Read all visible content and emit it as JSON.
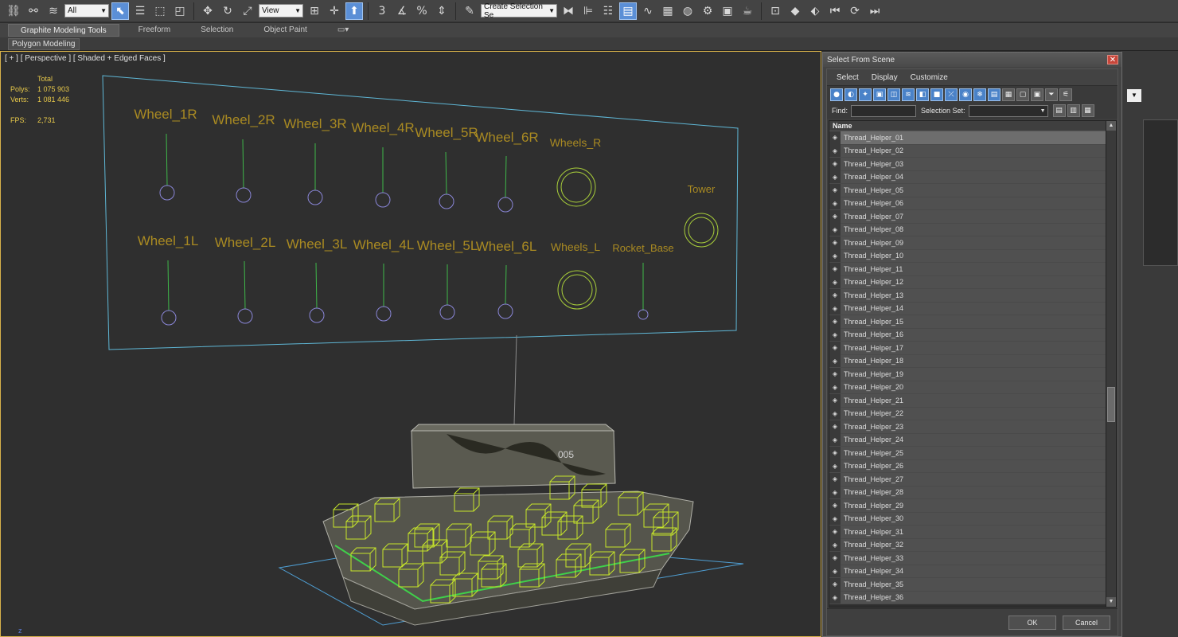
{
  "toolbar": {
    "filter_value": "All",
    "refcoord_value": "View",
    "selection_set_placeholder": "Create Selection Se",
    "icons": [
      "link-icon",
      "unlink-icon",
      "bind-spacewarp-icon",
      "select-object-icon",
      "select-by-name-icon",
      "rect-region-icon",
      "window-crossing-icon",
      "move-icon",
      "rotate-icon",
      "scale-icon",
      "pivot-icon",
      "select-manipulate-icon",
      "snap-toggle-icon",
      "angle-snap-icon",
      "percent-snap-icon",
      "spinner-snap-icon",
      "edit-named-sets-icon",
      "mirror-icon",
      "align-icon",
      "layer-manager-icon",
      "graphite-toggle-icon",
      "curve-editor-icon",
      "schematic-view-icon",
      "material-editor-icon",
      "render-setup-icon",
      "rendered-frame-icon",
      "render-icon"
    ]
  },
  "ribbon": {
    "tabs": [
      "Graphite Modeling Tools",
      "Freeform",
      "Selection",
      "Object Paint"
    ],
    "active_tab": "Graphite Modeling Tools",
    "panel_label": "Polygon Modeling"
  },
  "viewport": {
    "label": "[ + ] [ Perspective ] [ Shaded + Edged Faces ]",
    "stats_header": "Total",
    "polys_label": "Polys:",
    "polys_value": "1 075 903",
    "verts_label": "Verts:",
    "verts_value": "1 081 446",
    "fps_label": "FPS:",
    "fps_value": "2,731",
    "axis_label": "z",
    "controls_top": [
      "Wheel_1R",
      "Wheel_2R",
      "Wheel_3R",
      "Wheel_4R",
      "Wheel_5R",
      "Wheel_6R",
      "Wheels_R"
    ],
    "controls_bottom": [
      "Wheel_1L",
      "Wheel_2L",
      "Wheel_3L",
      "Wheel_4L",
      "Wheel_5L",
      "Wheel_6L",
      "Wheels_L",
      "Rocket_Base"
    ],
    "control_tower": "Tower",
    "vehicle_number": "005"
  },
  "dialog": {
    "title": "Select From Scene",
    "close_glyph": "✕",
    "menu": [
      "Select",
      "Display",
      "Customize"
    ],
    "find_label": "Find:",
    "find_value": "",
    "selection_set_label": "Selection Set:",
    "column_name": "Name",
    "items": [
      "Thread_Helper_01",
      "Thread_Helper_02",
      "Thread_Helper_03",
      "Thread_Helper_04",
      "Thread_Helper_05",
      "Thread_Helper_06",
      "Thread_Helper_07",
      "Thread_Helper_08",
      "Thread_Helper_09",
      "Thread_Helper_10",
      "Thread_Helper_11",
      "Thread_Helper_12",
      "Thread_Helper_13",
      "Thread_Helper_14",
      "Thread_Helper_15",
      "Thread_Helper_16",
      "Thread_Helper_17",
      "Thread_Helper_18",
      "Thread_Helper_19",
      "Thread_Helper_20",
      "Thread_Helper_21",
      "Thread_Helper_22",
      "Thread_Helper_23",
      "Thread_Helper_24",
      "Thread_Helper_25",
      "Thread_Helper_26",
      "Thread_Helper_27",
      "Thread_Helper_28",
      "Thread_Helper_29",
      "Thread_Helper_30",
      "Thread_Helper_31",
      "Thread_Helper_32",
      "Thread_Helper_33",
      "Thread_Helper_34",
      "Thread_Helper_35",
      "Thread_Helper_36"
    ],
    "selected_index": 0,
    "ok_label": "OK",
    "cancel_label": "Cancel"
  }
}
